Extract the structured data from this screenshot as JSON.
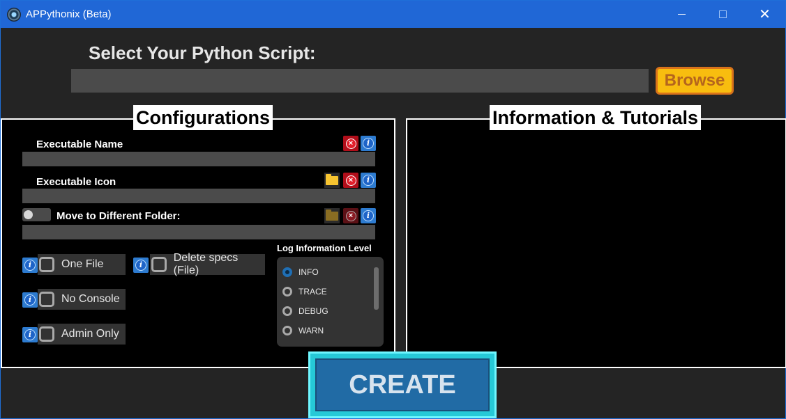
{
  "window": {
    "title": "APPythonix (Beta)",
    "min_label": "",
    "max_label": "",
    "close_label": "✕"
  },
  "script_select": {
    "heading": "Select Your Python Script:",
    "path_value": "",
    "browse_label": "Browse"
  },
  "configurations": {
    "title": "Configurations",
    "executable_name": {
      "label": "Executable Name",
      "value": ""
    },
    "executable_icon": {
      "label": "Executable Icon",
      "value": ""
    },
    "move_folder": {
      "label": "Move to Different Folder:",
      "value": "",
      "toggle_on": false
    },
    "checkboxes": [
      {
        "label": "One File",
        "checked": false
      },
      {
        "label": "No Console",
        "checked": false
      },
      {
        "label": "Admin Only",
        "checked": false
      },
      {
        "label": "Delete specs (File)",
        "checked": false
      }
    ],
    "log_level": {
      "label": "Log Information Level",
      "options": [
        "INFO",
        "TRACE",
        "DEBUG",
        "WARN"
      ],
      "selected": "INFO"
    }
  },
  "info_panel": {
    "title": "Information & Tutorials"
  },
  "create": {
    "label": "CREATE"
  },
  "icons": {
    "clear": "×",
    "info": "i"
  },
  "colors": {
    "titlebar": "#2067d6",
    "browse_bg": "#f8bd0f",
    "browse_text": "#b5651d",
    "create_border": "#26c9d7",
    "create_bg": "#216ba5"
  }
}
